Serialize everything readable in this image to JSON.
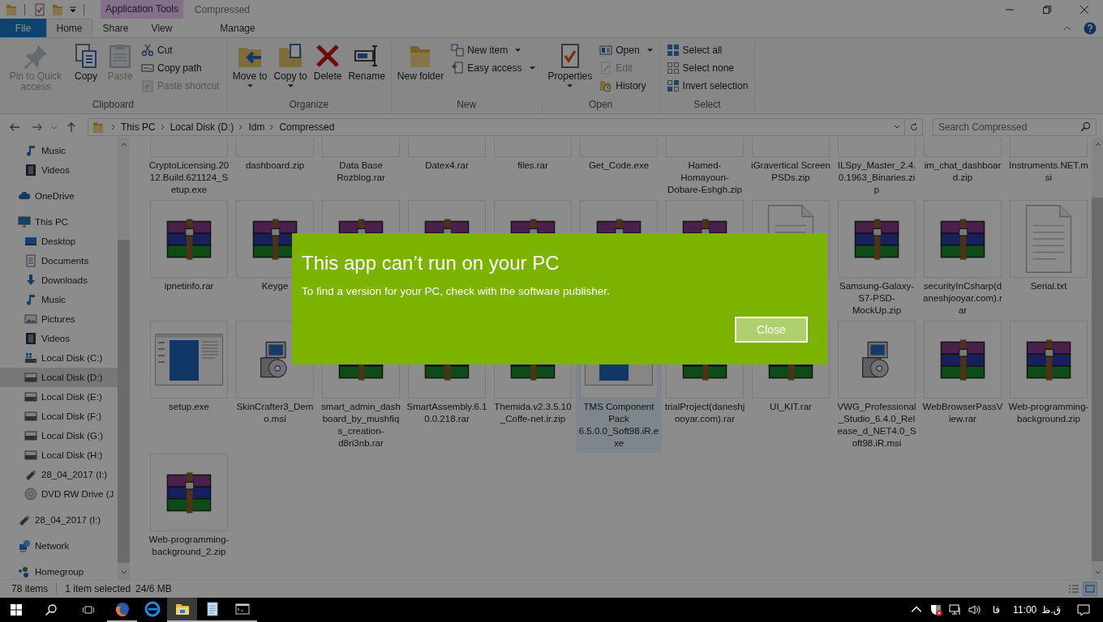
{
  "window": {
    "context_tab": "Application Tools",
    "title": "Compressed"
  },
  "tabs": [
    {
      "label": "File",
      "kind": "file",
      "selected": false
    },
    {
      "label": "Home",
      "kind": "normal",
      "selected": true
    },
    {
      "label": "Share",
      "kind": "normal",
      "selected": false
    },
    {
      "label": "View",
      "kind": "normal",
      "selected": false
    },
    {
      "label": "Manage",
      "kind": "context",
      "selected": false
    }
  ],
  "ribbon": [
    {
      "label": "Clipboard",
      "buttons": [
        {
          "kind": "large",
          "label": "Pin to Quick access",
          "disabled": true
        },
        {
          "kind": "large",
          "label": "Copy",
          "disabled": false
        },
        {
          "kind": "large",
          "label": "Paste",
          "disabled": true
        },
        {
          "kind": "small",
          "label": "Cut",
          "disabled": false
        },
        {
          "kind": "small",
          "label": "Copy path",
          "disabled": false
        },
        {
          "kind": "small",
          "label": "Paste shortcut",
          "disabled": true
        }
      ]
    },
    {
      "label": "Organize",
      "buttons": [
        {
          "kind": "large",
          "label": "Move to",
          "dropdown": true,
          "disabled": false
        },
        {
          "kind": "large",
          "label": "Copy to",
          "dropdown": true,
          "disabled": false
        },
        {
          "kind": "large",
          "label": "Delete",
          "disabled": false
        },
        {
          "kind": "large",
          "label": "Rename",
          "disabled": false
        }
      ]
    },
    {
      "label": "New",
      "buttons": [
        {
          "kind": "large",
          "label": "New folder",
          "disabled": false
        },
        {
          "kind": "small",
          "label": "New item",
          "dropdown": true,
          "disabled": false
        },
        {
          "kind": "small",
          "label": "Easy access",
          "dropdown": true,
          "disabled": false
        }
      ]
    },
    {
      "label": "Open",
      "buttons": [
        {
          "kind": "large",
          "label": "Properties",
          "dropdown": true,
          "disabled": false
        },
        {
          "kind": "small",
          "label": "Open",
          "dropdown": true,
          "disabled": false
        },
        {
          "kind": "small",
          "label": "Edit",
          "disabled": true
        },
        {
          "kind": "small",
          "label": "History",
          "disabled": false
        }
      ]
    },
    {
      "label": "Select",
      "buttons": [
        {
          "kind": "small",
          "label": "Select all",
          "disabled": false
        },
        {
          "kind": "small",
          "label": "Select none",
          "disabled": false
        },
        {
          "kind": "small",
          "label": "Invert selection",
          "disabled": false
        }
      ]
    }
  ],
  "address": {
    "path": [
      "This PC",
      "Local Disk (D:)",
      "Idm",
      "Compressed"
    ],
    "search_placeholder": "Search Compressed"
  },
  "sidebar": {
    "items": [
      {
        "children": [
          {
            "label": "Music",
            "kind": "music",
            "selected": false
          },
          {
            "label": "Videos",
            "kind": "film",
            "selected": false
          }
        ]
      },
      {
        "label": "OneDrive",
        "kind": "cloud",
        "selected": false
      },
      {
        "label": "This PC",
        "kind": "monitor",
        "selected": false,
        "children": [
          {
            "label": "Desktop",
            "kind": "desktop",
            "selected": false
          },
          {
            "label": "Documents",
            "kind": "document",
            "selected": false
          },
          {
            "label": "Downloads",
            "kind": "download",
            "selected": false
          },
          {
            "label": "Music",
            "kind": "music",
            "selected": false
          },
          {
            "label": "Pictures",
            "kind": "pictures",
            "selected": false
          },
          {
            "label": "Videos",
            "kind": "film",
            "selected": false
          },
          {
            "label": "Local Disk (C:)",
            "kind": "drive-windows",
            "selected": false
          },
          {
            "label": "Local Disk (D:)",
            "kind": "drive",
            "selected": true
          },
          {
            "label": "Local Disk (E:)",
            "kind": "drive",
            "selected": false
          },
          {
            "label": "Local Disk (F:)",
            "kind": "drive",
            "selected": false
          },
          {
            "label": "Local Disk (G:)",
            "kind": "drive",
            "selected": false
          },
          {
            "label": "Local Disk (H:)",
            "kind": "drive",
            "selected": false
          },
          {
            "label": "28_04_2017 (I:)",
            "kind": "usb",
            "selected": false
          },
          {
            "label": "DVD RW Drive (J",
            "kind": "disc",
            "selected": false
          }
        ]
      },
      {
        "label": "28_04_2017 (I:)",
        "kind": "usb",
        "selected": false
      },
      {
        "label": "Network",
        "kind": "network",
        "selected": false
      },
      {
        "label": "Homegroup",
        "kind": "homegroup",
        "selected": false
      }
    ]
  },
  "files": [
    {
      "name": "CryptoLicensing.2012.Build.621124_Setup.exe",
      "selected": false
    },
    {
      "name": "dashboard.zip",
      "selected": false
    },
    {
      "name": "Data Base Rozblog.rar",
      "selected": false
    },
    {
      "name": "Datex4.rar",
      "selected": false
    },
    {
      "name": "files.rar",
      "selected": false
    },
    {
      "name": "Get_Code.exe",
      "selected": false
    },
    {
      "name": "Hamed-Homayoun-Dobare-Eshgh.zip",
      "selected": false
    },
    {
      "name": "iGravertical Screen PSDs.zip",
      "selected": false
    },
    {
      "name": "ILSpy_Master_2.4.0.1963_Binaries.zip",
      "selected": false
    },
    {
      "name": "im_chat_dashboard.zip",
      "selected": false
    },
    {
      "name": "Instruments.NET.msi",
      "selected": false
    },
    {
      "name": "ipnetinfo.rar",
      "kind": "archive",
      "selected": false
    },
    {
      "name": "Keyge",
      "kind": "archive",
      "selected": false
    },
    {
      "kind": "archive",
      "selected": false
    },
    {
      "kind": "archive",
      "selected": false
    },
    {
      "kind": "archive",
      "selected": false
    },
    {
      "kind": "archive",
      "selected": false
    },
    {
      "kind": "archive",
      "selected": false
    },
    {
      "kind": "text",
      "selected": false
    },
    {
      "name": "Samsung-Galaxy-S7-PSD-MockUp.zip",
      "kind": "archive",
      "selected": false
    },
    {
      "name": "securityInCsharp(daneshjooyar.com).rar",
      "kind": "archive",
      "selected": false
    },
    {
      "name": "Serial.txt",
      "kind": "text",
      "selected": false
    },
    {
      "name": "setup.exe",
      "kind": "app",
      "selected": false
    },
    {
      "name": "SkinCrafter3_Demo.msi",
      "kind": "installer",
      "selected": false
    },
    {
      "name": "smart_admin_dashboard_by_mushfiqs_creation-d8ri3nb.rar",
      "kind": "archive",
      "selected": false
    },
    {
      "name": "SmartAssembly.6.10.0.218.rar",
      "kind": "archive",
      "selected": false
    },
    {
      "name": "Themida.v2.3.5.10_Coffe-net.ir.zip",
      "kind": "archive",
      "selected": false
    },
    {
      "name": "TMS Component Pack 6.5.0.0_Soft98.iR.exe",
      "kind": "app",
      "selected": true
    },
    {
      "name": "trialProject(daneshjooyar.com).rar",
      "kind": "archive",
      "selected": false
    },
    {
      "name": "UI_KIT.rar",
      "kind": "archive",
      "selected": false
    },
    {
      "name": "VWG_Professional_Studio_6.4.0_Release_d_NET4.0_Soft98.iR.msi",
      "kind": "installer",
      "selected": false
    },
    {
      "name": "WebBrowserPassView.rar",
      "kind": "archive",
      "selected": false
    },
    {
      "name": "Web-programming-background.zip",
      "kind": "archive",
      "selected": false
    },
    {
      "name": "Web-programming-background_2.zip",
      "kind": "archive",
      "selected": false
    }
  ],
  "status_bar": {
    "count": "78 items",
    "selection": "1 item selected",
    "size": "24/6 MB",
    "view_modes": [
      {
        "kind": "details",
        "selected": false
      },
      {
        "kind": "large-icons",
        "selected": true
      }
    ]
  },
  "dialog": {
    "title": "This app can’t run on your PC",
    "message": "To find a version for your PC, check with the software publisher.",
    "button": "Close"
  },
  "taskbar": {
    "apps": [
      {
        "kind": "browser-fox",
        "running": true,
        "selected": false
      },
      {
        "kind": "browser-e",
        "running": false,
        "selected": false
      },
      {
        "kind": "folder",
        "running": true,
        "selected": true
      },
      {
        "kind": "notepad",
        "running": true,
        "selected": false
      },
      {
        "kind": "console",
        "running": true,
        "selected": false
      }
    ],
    "language": "فا",
    "time": "11:00",
    "period": "ق.ظ"
  }
}
